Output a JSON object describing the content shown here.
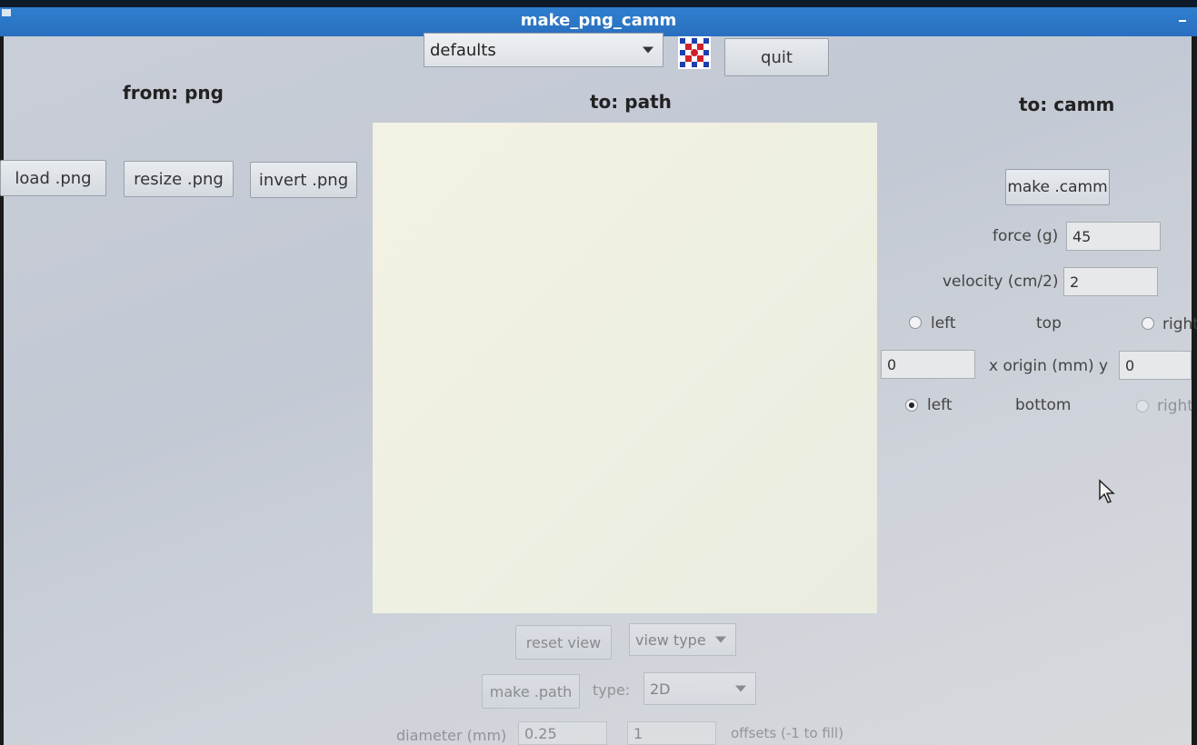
{
  "window": {
    "title": "make_png_camm"
  },
  "toolbar": {
    "preset_value": "defaults",
    "quit_label": "quit",
    "logo_icon": "fab-logo-icon"
  },
  "from": {
    "heading": "from: png",
    "load_label": "load .png",
    "resize_label": "resize .png",
    "invert_label": "invert .png"
  },
  "path": {
    "heading": "to: path",
    "reset_view_label": "reset view",
    "view_type_value": "view type",
    "make_path_label": "make .path",
    "type_label": "type:",
    "type_value": "2D",
    "diameter_label": "diameter (mm)",
    "diameter_value": "0.25",
    "offsets_value": "1",
    "offsets_label": "offsets (-1 to fill)"
  },
  "camm": {
    "heading": "to: camm",
    "make_label": "make .camm",
    "force_label": "force (g)",
    "force_value": "45",
    "velocity_label": "velocity (cm/2)",
    "velocity_value": "2",
    "top_left_label": "left",
    "top_label": "top",
    "top_right_label": "right",
    "origin_x_value": "0",
    "origin_label": "x  origin (mm)  y",
    "origin_y_value": "0",
    "bottom_left_label": "left",
    "bottom_label": "bottom",
    "bottom_right_label": "right",
    "selected_corner": "bottom-left"
  },
  "colors": {
    "titlebar": "#2f7fcf",
    "background": "#c9ced8",
    "canvas": "#f3f1e4"
  }
}
